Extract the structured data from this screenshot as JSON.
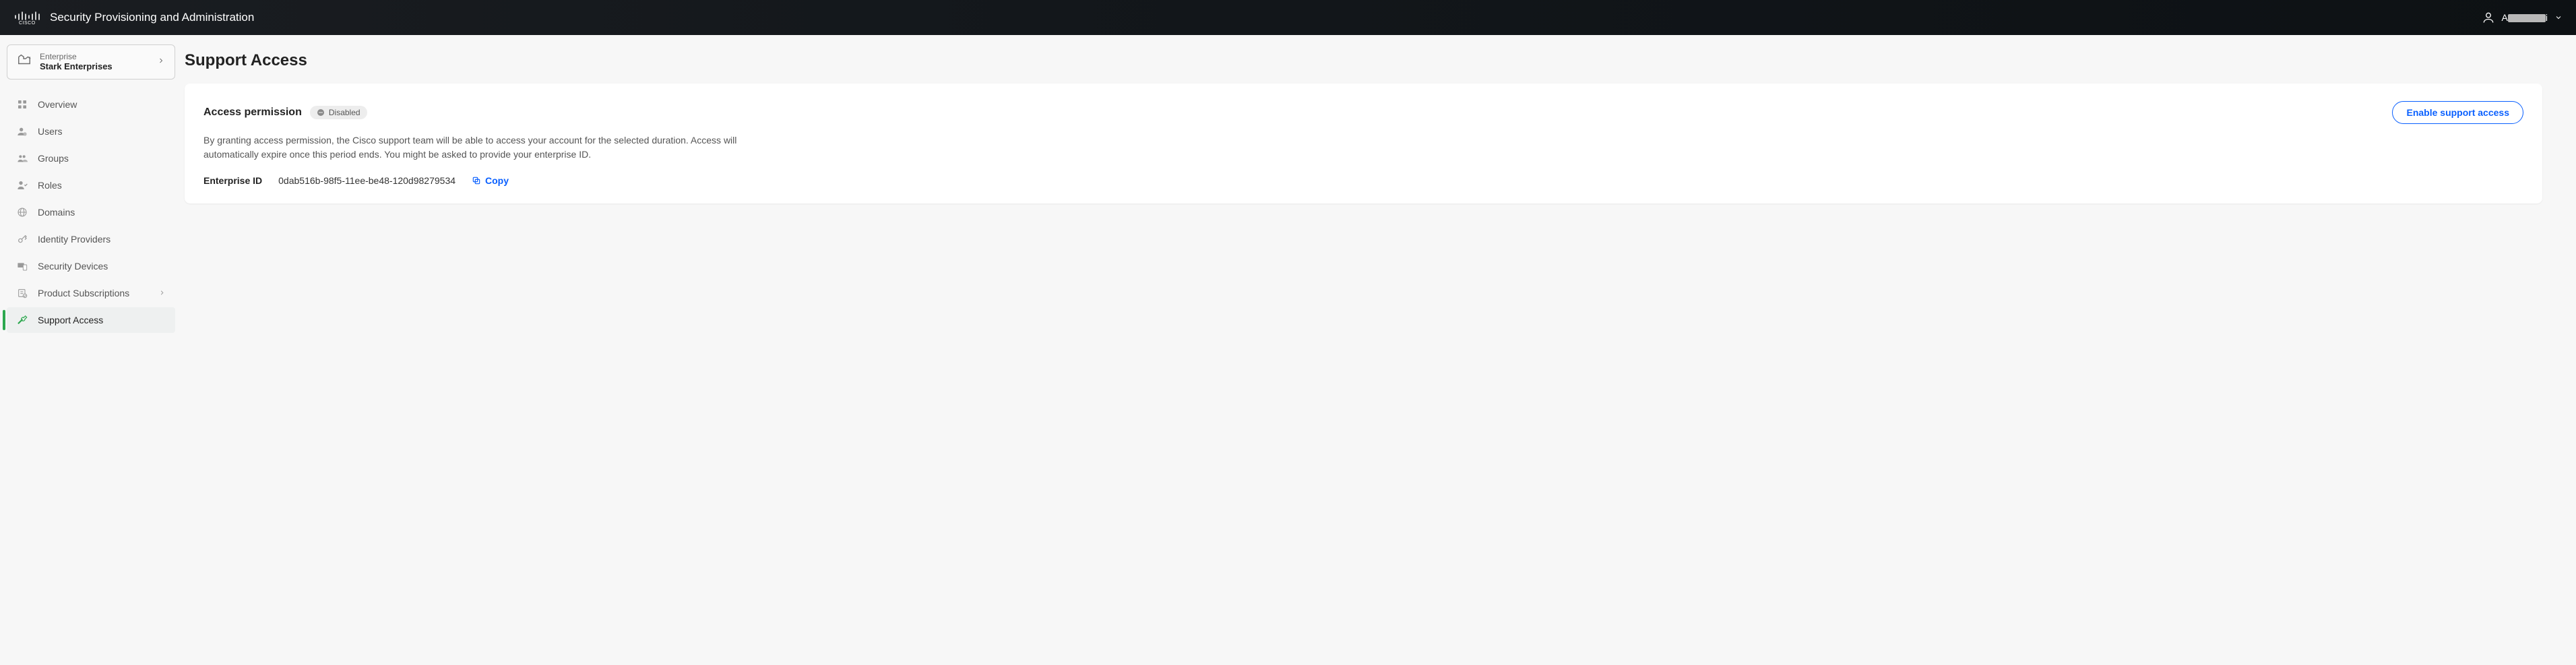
{
  "header": {
    "app_title": "Security Provisioning and Administration",
    "user_name_prefix": "A",
    "user_name_suffix": "i"
  },
  "sidebar": {
    "enterprise_label": "Enterprise",
    "enterprise_name": "Stark Enterprises",
    "items": [
      {
        "icon": "overview",
        "label": "Overview",
        "active": false,
        "has_chevron": false
      },
      {
        "icon": "users",
        "label": "Users",
        "active": false,
        "has_chevron": false
      },
      {
        "icon": "groups",
        "label": "Groups",
        "active": false,
        "has_chevron": false
      },
      {
        "icon": "roles",
        "label": "Roles",
        "active": false,
        "has_chevron": false
      },
      {
        "icon": "domains",
        "label": "Domains",
        "active": false,
        "has_chevron": false
      },
      {
        "icon": "idp",
        "label": "Identity Providers",
        "active": false,
        "has_chevron": false
      },
      {
        "icon": "devices",
        "label": "Security Devices",
        "active": false,
        "has_chevron": false
      },
      {
        "icon": "subscriptions",
        "label": "Product Subscriptions",
        "active": false,
        "has_chevron": true
      },
      {
        "icon": "support",
        "label": "Support Access",
        "active": true,
        "has_chevron": false
      }
    ]
  },
  "page": {
    "title": "Support Access",
    "section_title": "Access permission",
    "status_label": "Disabled",
    "enable_button": "Enable support access",
    "description": "By granting access permission, the Cisco support team will be able to access your account for the selected duration. Access will automatically expire once this period ends. You might be asked to provide your enterprise ID.",
    "enterprise_id_label": "Enterprise ID",
    "enterprise_id_value": "0dab516b-98f5-11ee-be48-120d98279534",
    "copy_label": "Copy"
  }
}
